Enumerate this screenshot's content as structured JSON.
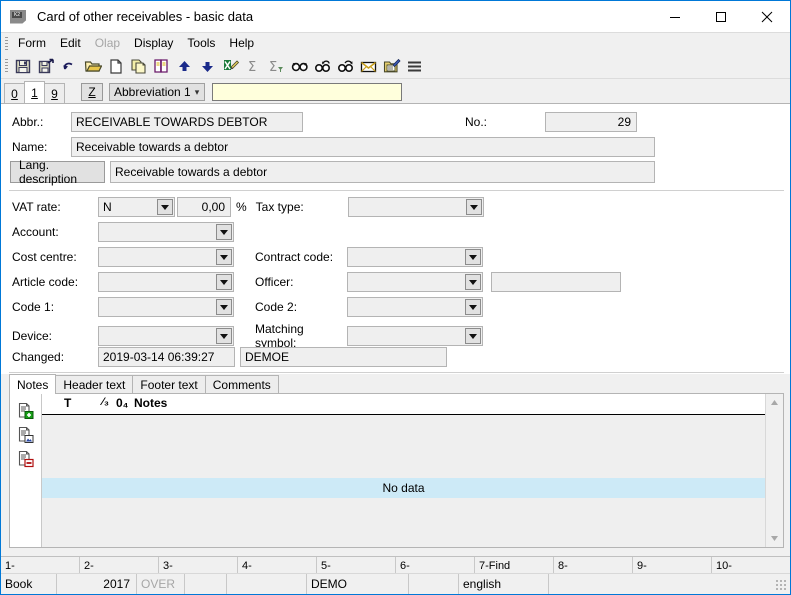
{
  "window": {
    "title": "Card of other receivables - basic data",
    "app_icon": "app-icon",
    "minimize": "—",
    "maximize": "☐",
    "close": "✕"
  },
  "menu": {
    "items": [
      {
        "label": "Form",
        "disabled": false
      },
      {
        "label": "Edit",
        "disabled": false
      },
      {
        "label": "Olap",
        "disabled": true
      },
      {
        "label": "Display",
        "disabled": false
      },
      {
        "label": "Tools",
        "disabled": false
      },
      {
        "label": "Help",
        "disabled": false
      }
    ]
  },
  "toolbar": {
    "buttons": [
      {
        "name": "save-icon"
      },
      {
        "name": "save-as-icon"
      },
      {
        "name": "undo-icon"
      },
      {
        "name": "open-folder-icon"
      },
      {
        "name": "new-document-icon"
      },
      {
        "name": "copy-icon"
      },
      {
        "name": "book-icon"
      },
      {
        "name": "move-up-icon"
      },
      {
        "name": "move-down-icon"
      },
      {
        "name": "export-excel-icon"
      },
      {
        "name": "sum-icon"
      },
      {
        "name": "sum-filtered-icon"
      },
      {
        "name": "find-icon"
      },
      {
        "name": "find-previous-icon"
      },
      {
        "name": "find-next-icon"
      },
      {
        "name": "mail-icon"
      },
      {
        "name": "edit-note-icon"
      },
      {
        "name": "menu-list-icon"
      }
    ]
  },
  "index_tabs": {
    "tabs": [
      {
        "label": "0",
        "selected": false
      },
      {
        "label": "1",
        "selected": true
      },
      {
        "label": "9",
        "selected": false
      }
    ],
    "z_button": "Z",
    "sort_combo_value": "Abbreviation 1",
    "search_value": "",
    "search_placeholder": ""
  },
  "form": {
    "abbr_label": "Abbr.:",
    "abbr_value": "RECEIVABLE TOWARDS DEBTOR",
    "no_label": "No.:",
    "no_value": "29",
    "name_label": "Name:",
    "name_value": "Receivable towards a debtor",
    "lang_description_button": "Lang. description",
    "lang_description_value": "Receivable towards a debtor",
    "vat_rate_label": "VAT rate:",
    "vat_rate_value": "N",
    "vat_percent_value": "0,00",
    "percent_sign": "%",
    "tax_type_label": "Tax type:",
    "tax_type_value": "",
    "account_label": "Account:",
    "account_value": "",
    "cost_centre_label": "Cost centre:",
    "cost_centre_value": "",
    "contract_code_label": "Contract code:",
    "contract_code_value": "",
    "article_code_label": "Article code:",
    "article_code_value": "",
    "officer_label": "Officer:",
    "officer_value": "",
    "officer_extra_value": "",
    "code1_label": "Code 1:",
    "code1_value": "",
    "code2_label": "Code 2:",
    "code2_value": "",
    "device_label": "Device:",
    "device_value": "",
    "matching_symbol_label": "Matching symbol:",
    "matching_symbol_value": "",
    "changed_label": "Changed:",
    "changed_value": "2019-03-14 06:39:27",
    "changed_user": "DEMOE"
  },
  "bottom_tabs": {
    "tabs": [
      {
        "label": "Notes",
        "selected": true
      },
      {
        "label": "Header text",
        "selected": false
      },
      {
        "label": "Footer text",
        "selected": false
      },
      {
        "label": "Comments",
        "selected": false
      }
    ]
  },
  "notes_panel": {
    "side_buttons": [
      {
        "name": "add-note-icon"
      },
      {
        "name": "edit-note-icon"
      },
      {
        "name": "delete-note-icon"
      }
    ],
    "columns": [
      {
        "label": "T"
      },
      {
        "label": "⁄₃"
      },
      {
        "label": "0₄"
      },
      {
        "label": "Notes"
      }
    ],
    "empty_message": "No data",
    "scroll_up": "▲",
    "scroll_down": "▼"
  },
  "fkeys": {
    "items": [
      {
        "label": "1-"
      },
      {
        "label": "2-"
      },
      {
        "label": "3-"
      },
      {
        "label": "4-"
      },
      {
        "label": "5-"
      },
      {
        "label": "6-"
      },
      {
        "label": "7-Find"
      },
      {
        "label": "8-"
      },
      {
        "label": "9-"
      },
      {
        "label": "10-"
      }
    ]
  },
  "statusbar": {
    "mode": "Book",
    "blank1": "",
    "year": "2017",
    "overwrite": "OVER",
    "blank2": "",
    "blank3": "",
    "company": "DEMO",
    "blank4": "",
    "language": "english",
    "blank5": ""
  },
  "colors": {
    "window_border": "#0078d7",
    "field_bg": "#efefef",
    "search_bg": "#ffffdc",
    "row_highlight": "#cdeaf7",
    "toolbar_bg": "#f0f0f0"
  }
}
